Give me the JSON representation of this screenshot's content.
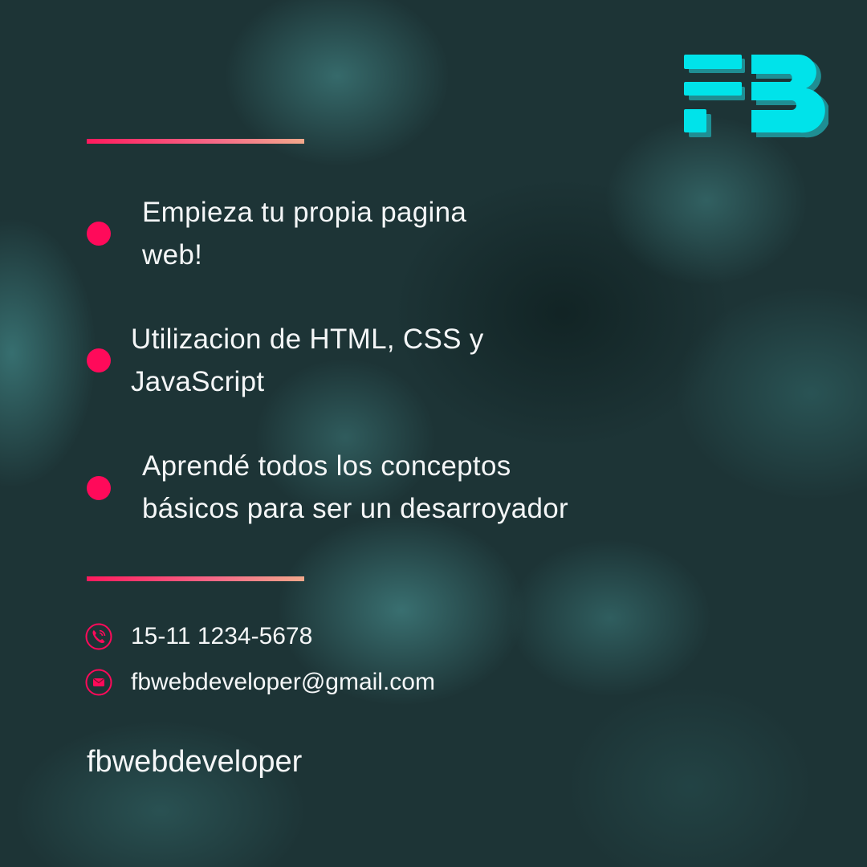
{
  "brand": {
    "logo_icon": "fb-logo-icon",
    "accent_color": "#00e0e8",
    "highlight_color": "#ff0a5a"
  },
  "bullets": [
    {
      "text": "Empieza tu propia pagina\nweb!"
    },
    {
      "text": "Utilizacion de HTML, CSS y\nJavaScript"
    },
    {
      "text": "Aprendé todos los conceptos\nbásicos para ser un desarroyador"
    }
  ],
  "contact": {
    "phone_icon": "phone-icon",
    "phone": "15-11 1234-5678",
    "email_icon": "mail-icon",
    "email": "fbwebdeveloper@gmail.com"
  },
  "handle": "fbwebdeveloper"
}
